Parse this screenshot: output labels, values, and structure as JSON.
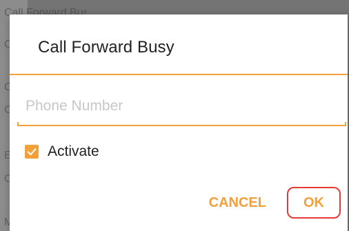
{
  "background": {
    "lines": [
      "Call Forward Busy",
      "C",
      "C",
      "C",
      "E",
      "C",
      "M"
    ]
  },
  "dialog": {
    "title": "Call Forward Busy",
    "accent_color": "#f3a03a",
    "phone_input": {
      "placeholder": "Phone Number",
      "value": ""
    },
    "checkbox": {
      "label": "Activate",
      "checked": true
    },
    "buttons": {
      "cancel_label": "CANCEL",
      "ok_label": "OK"
    },
    "highlight_color": "#e53935"
  }
}
